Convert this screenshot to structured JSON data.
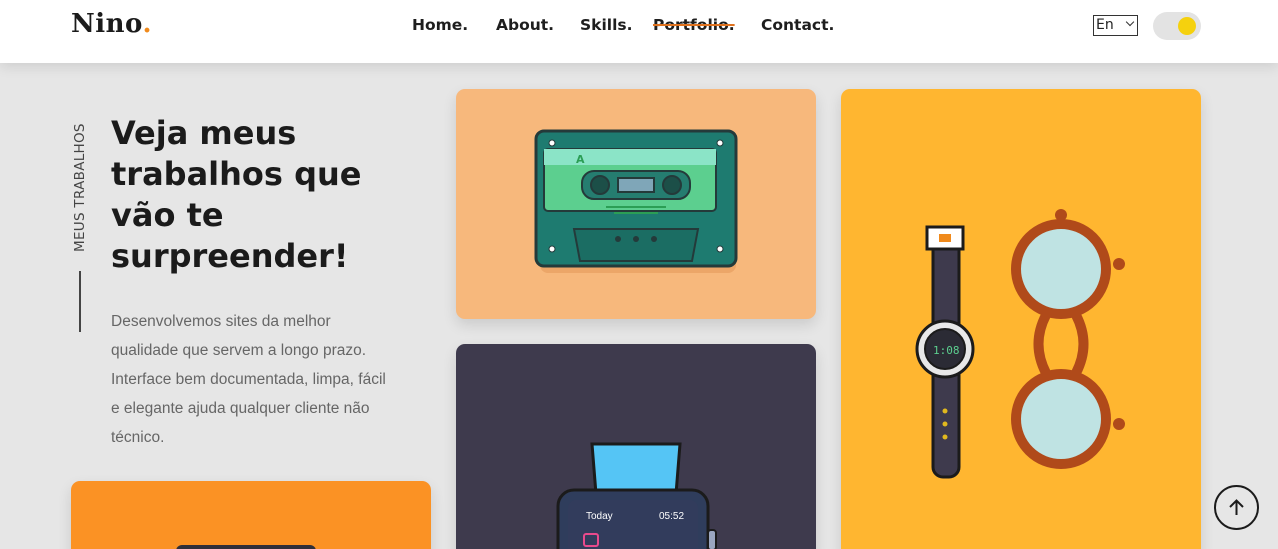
{
  "header": {
    "logo": "Nino",
    "logo_dot": ".",
    "nav": [
      "Home.",
      "About.",
      "Skills.",
      "Portfolio.",
      "Contact."
    ],
    "language": "En",
    "theme_toggle": "on"
  },
  "hero": {
    "side_label": "MEUS TRABALHOS",
    "heading_lines": [
      "Veja meus",
      "trabalhos que",
      "vão te",
      "surpreender!"
    ],
    "description_lines": [
      "Desenvolvemos sites da melhor",
      "qualidade que servem a longo prazo.",
      "Interface bem documentada, limpa, fácil",
      "e elegante ajuda qualquer cliente não",
      "técnico."
    ]
  },
  "portfolio": {
    "cards": [
      {
        "illustration": "cassette-tape",
        "background": "#f7b87c",
        "tape_label": "A"
      },
      {
        "illustration": "watch-and-glasses",
        "background": "#ffb630",
        "watch_time": "1:08"
      },
      {
        "illustration": "smartwatch",
        "background": "#3e3a4d",
        "screen_title": "Today",
        "screen_time": "05:52"
      },
      {
        "illustration": "unknown",
        "background": "#fb9224"
      }
    ]
  },
  "colors": {
    "accent": "#f08a1c",
    "page_background": "#e6e6e6",
    "toggle_knob": "#f5d10e"
  }
}
